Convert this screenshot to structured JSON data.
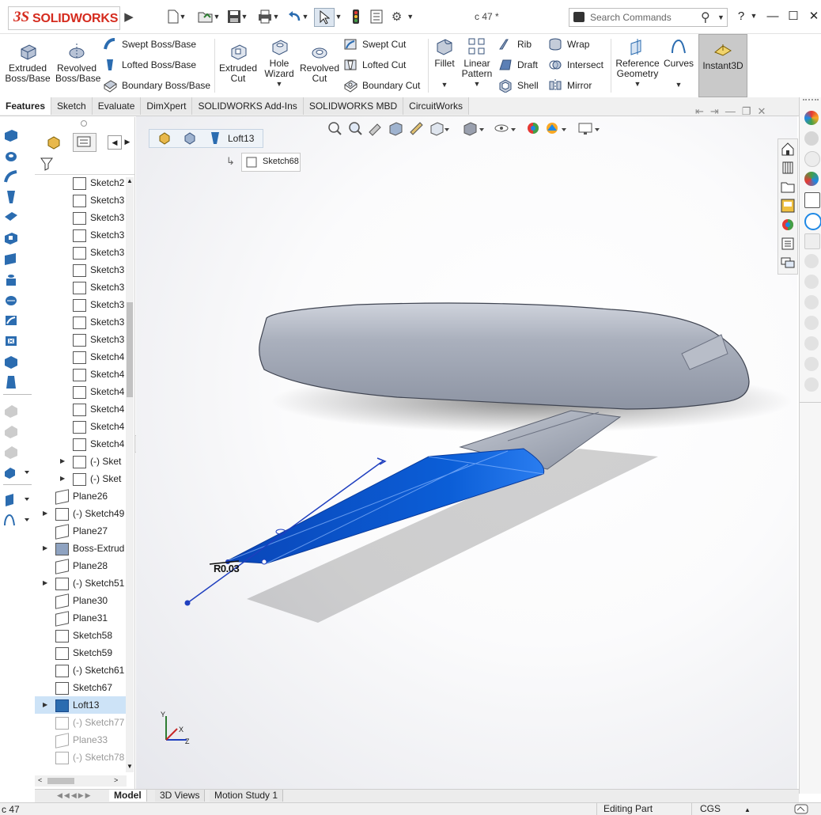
{
  "app": {
    "name": "SOLIDWORKS",
    "document_title": "c 47 *"
  },
  "search": {
    "placeholder": "Search Commands"
  },
  "help_label": "?",
  "ribbon": {
    "extruded_boss": "Extruded Boss/Base",
    "revolved_boss": "Revolved Boss/Base",
    "swept_boss": "Swept Boss/Base",
    "lofted_boss": "Lofted Boss/Base",
    "boundary_boss": "Boundary Boss/Base",
    "extruded_cut": "Extruded Cut",
    "hole_wizard": "Hole Wizard",
    "revolved_cut": "Revolved Cut",
    "swept_cut": "Swept Cut",
    "lofted_cut": "Lofted Cut",
    "boundary_cut": "Boundary Cut",
    "fillet": "Fillet",
    "linear_pattern": "Linear Pattern",
    "rib": "Rib",
    "draft": "Draft",
    "shell": "Shell",
    "wrap": "Wrap",
    "intersect": "Intersect",
    "mirror": "Mirror",
    "reference_geometry": "Reference Geometry",
    "curves": "Curves",
    "instant3d": "Instant3D"
  },
  "tabs": [
    "Features",
    "Sketch",
    "Evaluate",
    "DimXpert",
    "SOLIDWORKS Add-Ins",
    "SOLIDWORKS MBD",
    "CircuitWorks"
  ],
  "tree": {
    "items": [
      {
        "label": "Sketch2",
        "state": "normal",
        "expand": false
      },
      {
        "label": "Sketch3",
        "state": "normal",
        "expand": false
      },
      {
        "label": "Sketch3",
        "state": "normal",
        "expand": false
      },
      {
        "label": "Sketch3",
        "state": "normal",
        "expand": false
      },
      {
        "label": "Sketch3",
        "state": "normal",
        "expand": false
      },
      {
        "label": "Sketch3",
        "state": "normal",
        "expand": false
      },
      {
        "label": "Sketch3",
        "state": "normal",
        "expand": false
      },
      {
        "label": "Sketch3",
        "state": "normal",
        "expand": false
      },
      {
        "label": "Sketch3",
        "state": "normal",
        "expand": false
      },
      {
        "label": "Sketch3",
        "state": "normal",
        "expand": false
      },
      {
        "label": "Sketch4",
        "state": "normal",
        "expand": false
      },
      {
        "label": "Sketch4",
        "state": "normal",
        "expand": false
      },
      {
        "label": "Sketch4",
        "state": "normal",
        "expand": false
      },
      {
        "label": "Sketch4",
        "state": "normal",
        "expand": false
      },
      {
        "label": "Sketch4",
        "state": "normal",
        "expand": false
      },
      {
        "label": "Sketch4",
        "state": "normal",
        "expand": false
      },
      {
        "label": "(-) Sket",
        "state": "normal",
        "expand": true
      },
      {
        "label": "(-) Sket",
        "state": "normal",
        "expand": true
      },
      {
        "label": "Plane26",
        "state": "normal",
        "expand": false
      },
      {
        "label": "(-) Sketch49",
        "state": "normal",
        "expand": true
      },
      {
        "label": "Plane27",
        "state": "normal",
        "expand": false
      },
      {
        "label": "Boss-Extrud",
        "state": "normal",
        "expand": true
      },
      {
        "label": "Plane28",
        "state": "normal",
        "expand": false
      },
      {
        "label": "(-) Sketch51",
        "state": "normal",
        "expand": true
      },
      {
        "label": "Plane30",
        "state": "normal",
        "expand": false
      },
      {
        "label": "Plane31",
        "state": "normal",
        "expand": false
      },
      {
        "label": "Sketch58",
        "state": "normal",
        "expand": false
      },
      {
        "label": "Sketch59",
        "state": "normal",
        "expand": false
      },
      {
        "label": "(-) Sketch61",
        "state": "normal",
        "expand": false
      },
      {
        "label": "Sketch67",
        "state": "normal",
        "expand": false
      },
      {
        "label": "Loft13",
        "state": "selected",
        "expand": true
      },
      {
        "label": "(-) Sketch77",
        "state": "dim",
        "expand": false
      },
      {
        "label": "Plane33",
        "state": "dim",
        "expand": false
      },
      {
        "label": "(-) Sketch78",
        "state": "dim",
        "expand": false
      }
    ]
  },
  "viewport": {
    "breadcrumb": "Loft13",
    "breadcrumb_sub": "Sketch68",
    "dimension_label": "R0.03",
    "triad": {
      "y": "Y",
      "x": "X",
      "z": "Z"
    }
  },
  "bottom_tabs": [
    "Model",
    "3D Views",
    "Motion Study 1"
  ],
  "status": {
    "file": "c 47",
    "mode": "Editing Part",
    "units": "CGS"
  },
  "colors": {
    "accent": "#0b5ed7",
    "body": "#9aa0ae",
    "brand": "#d52b1e"
  }
}
